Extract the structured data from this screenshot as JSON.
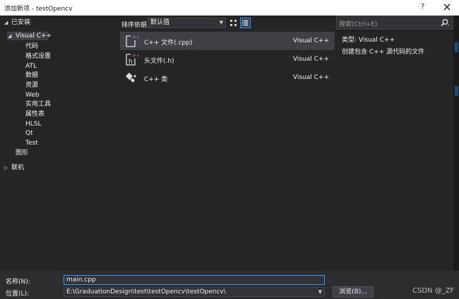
{
  "window": {
    "title": "添加新项 - testOpencv",
    "help_label": "?",
    "close_icon": "close-icon"
  },
  "tree": {
    "installed": "已安装",
    "visual_cpp": "Visual C++",
    "children": [
      "代码",
      "格式设置",
      "ATL",
      "数据",
      "资源",
      "Web",
      "实用工具",
      "属性表",
      "HLSL",
      "Qt",
      "Test"
    ],
    "graphics": "图形",
    "online": "联机"
  },
  "toolbar": {
    "sort_label": "排序依据:",
    "sort_value": "默认值"
  },
  "templates": [
    {
      "name": "C++ 文件(.cpp)",
      "lang": "Visual C++",
      "icon": "cpp-file-icon"
    },
    {
      "name": "头文件(.h)",
      "lang": "Visual C++",
      "icon": "header-file-icon"
    },
    {
      "name": "C++ 类",
      "lang": "Visual C++",
      "icon": "cpp-class-icon"
    }
  ],
  "search": {
    "placeholder": "搜索(Ctrl+E)"
  },
  "details": {
    "type": "类型:  Visual C++",
    "description": "创建包含 C++ 源代码的文件"
  },
  "bottom": {
    "name_label": "名称(N):",
    "name_value": "main.cpp",
    "location_label": "位置(L):",
    "location_value": "E:\\GraduationDesign\\test\\testOpencv\\testOpencv\\",
    "browse_label": "浏览(B)...",
    "watermark": "CSDN @_ZF"
  },
  "colors": {
    "accent": "#3399ff",
    "icon_purple": "#b180d7",
    "background": "#252526"
  }
}
